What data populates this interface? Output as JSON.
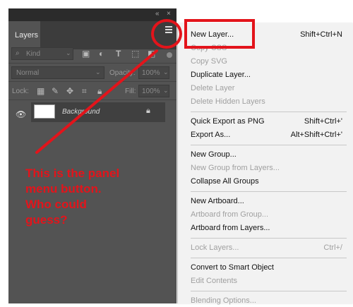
{
  "panel": {
    "tab_label": "Layers",
    "filter": {
      "kind_label": "Kind"
    },
    "blend_mode": "Normal",
    "opacity_label": "Opacity:",
    "opacity_value": "100%",
    "lock_label": "Lock:",
    "fill_label": "Fill:",
    "fill_value": "100%",
    "layers": [
      {
        "name": "Background",
        "locked": true,
        "visible": true
      }
    ]
  },
  "menu": {
    "items": [
      {
        "label": "New Layer...",
        "shortcut": "Shift+Ctrl+N",
        "enabled": true
      },
      {
        "label": "Copy CSS",
        "shortcut": "",
        "enabled": false
      },
      {
        "label": "Copy SVG",
        "shortcut": "",
        "enabled": false
      },
      {
        "label": "Duplicate Layer...",
        "shortcut": "",
        "enabled": true
      },
      {
        "label": "Delete Layer",
        "shortcut": "",
        "enabled": false
      },
      {
        "label": "Delete Hidden Layers",
        "shortcut": "",
        "enabled": false
      },
      {
        "label": "Quick Export as PNG",
        "shortcut": "Shift+Ctrl+'",
        "enabled": true
      },
      {
        "label": "Export As...",
        "shortcut": "Alt+Shift+Ctrl+'",
        "enabled": true
      },
      {
        "label": "New Group...",
        "shortcut": "",
        "enabled": true
      },
      {
        "label": "New Group from Layers...",
        "shortcut": "",
        "enabled": false
      },
      {
        "label": "Collapse All Groups",
        "shortcut": "",
        "enabled": true
      },
      {
        "label": "New Artboard...",
        "shortcut": "",
        "enabled": true
      },
      {
        "label": "Artboard from Group...",
        "shortcut": "",
        "enabled": false
      },
      {
        "label": "Artboard from Layers...",
        "shortcut": "",
        "enabled": true
      },
      {
        "label": "Lock Layers...",
        "shortcut": "Ctrl+/",
        "enabled": false
      },
      {
        "label": "Convert to Smart Object",
        "shortcut": "",
        "enabled": true
      },
      {
        "label": "Edit Contents",
        "shortcut": "",
        "enabled": false
      },
      {
        "label": "Blending Options...",
        "shortcut": "",
        "enabled": false
      }
    ]
  },
  "annotation": {
    "lines": [
      "This is the panel",
      "menu button.",
      "Who could",
      "guess?"
    ],
    "color": "#e3141b"
  },
  "colors": {
    "panel_bg": "#535353",
    "menu_bg": "#f2f2f2",
    "annotation_red": "#e3141b"
  }
}
